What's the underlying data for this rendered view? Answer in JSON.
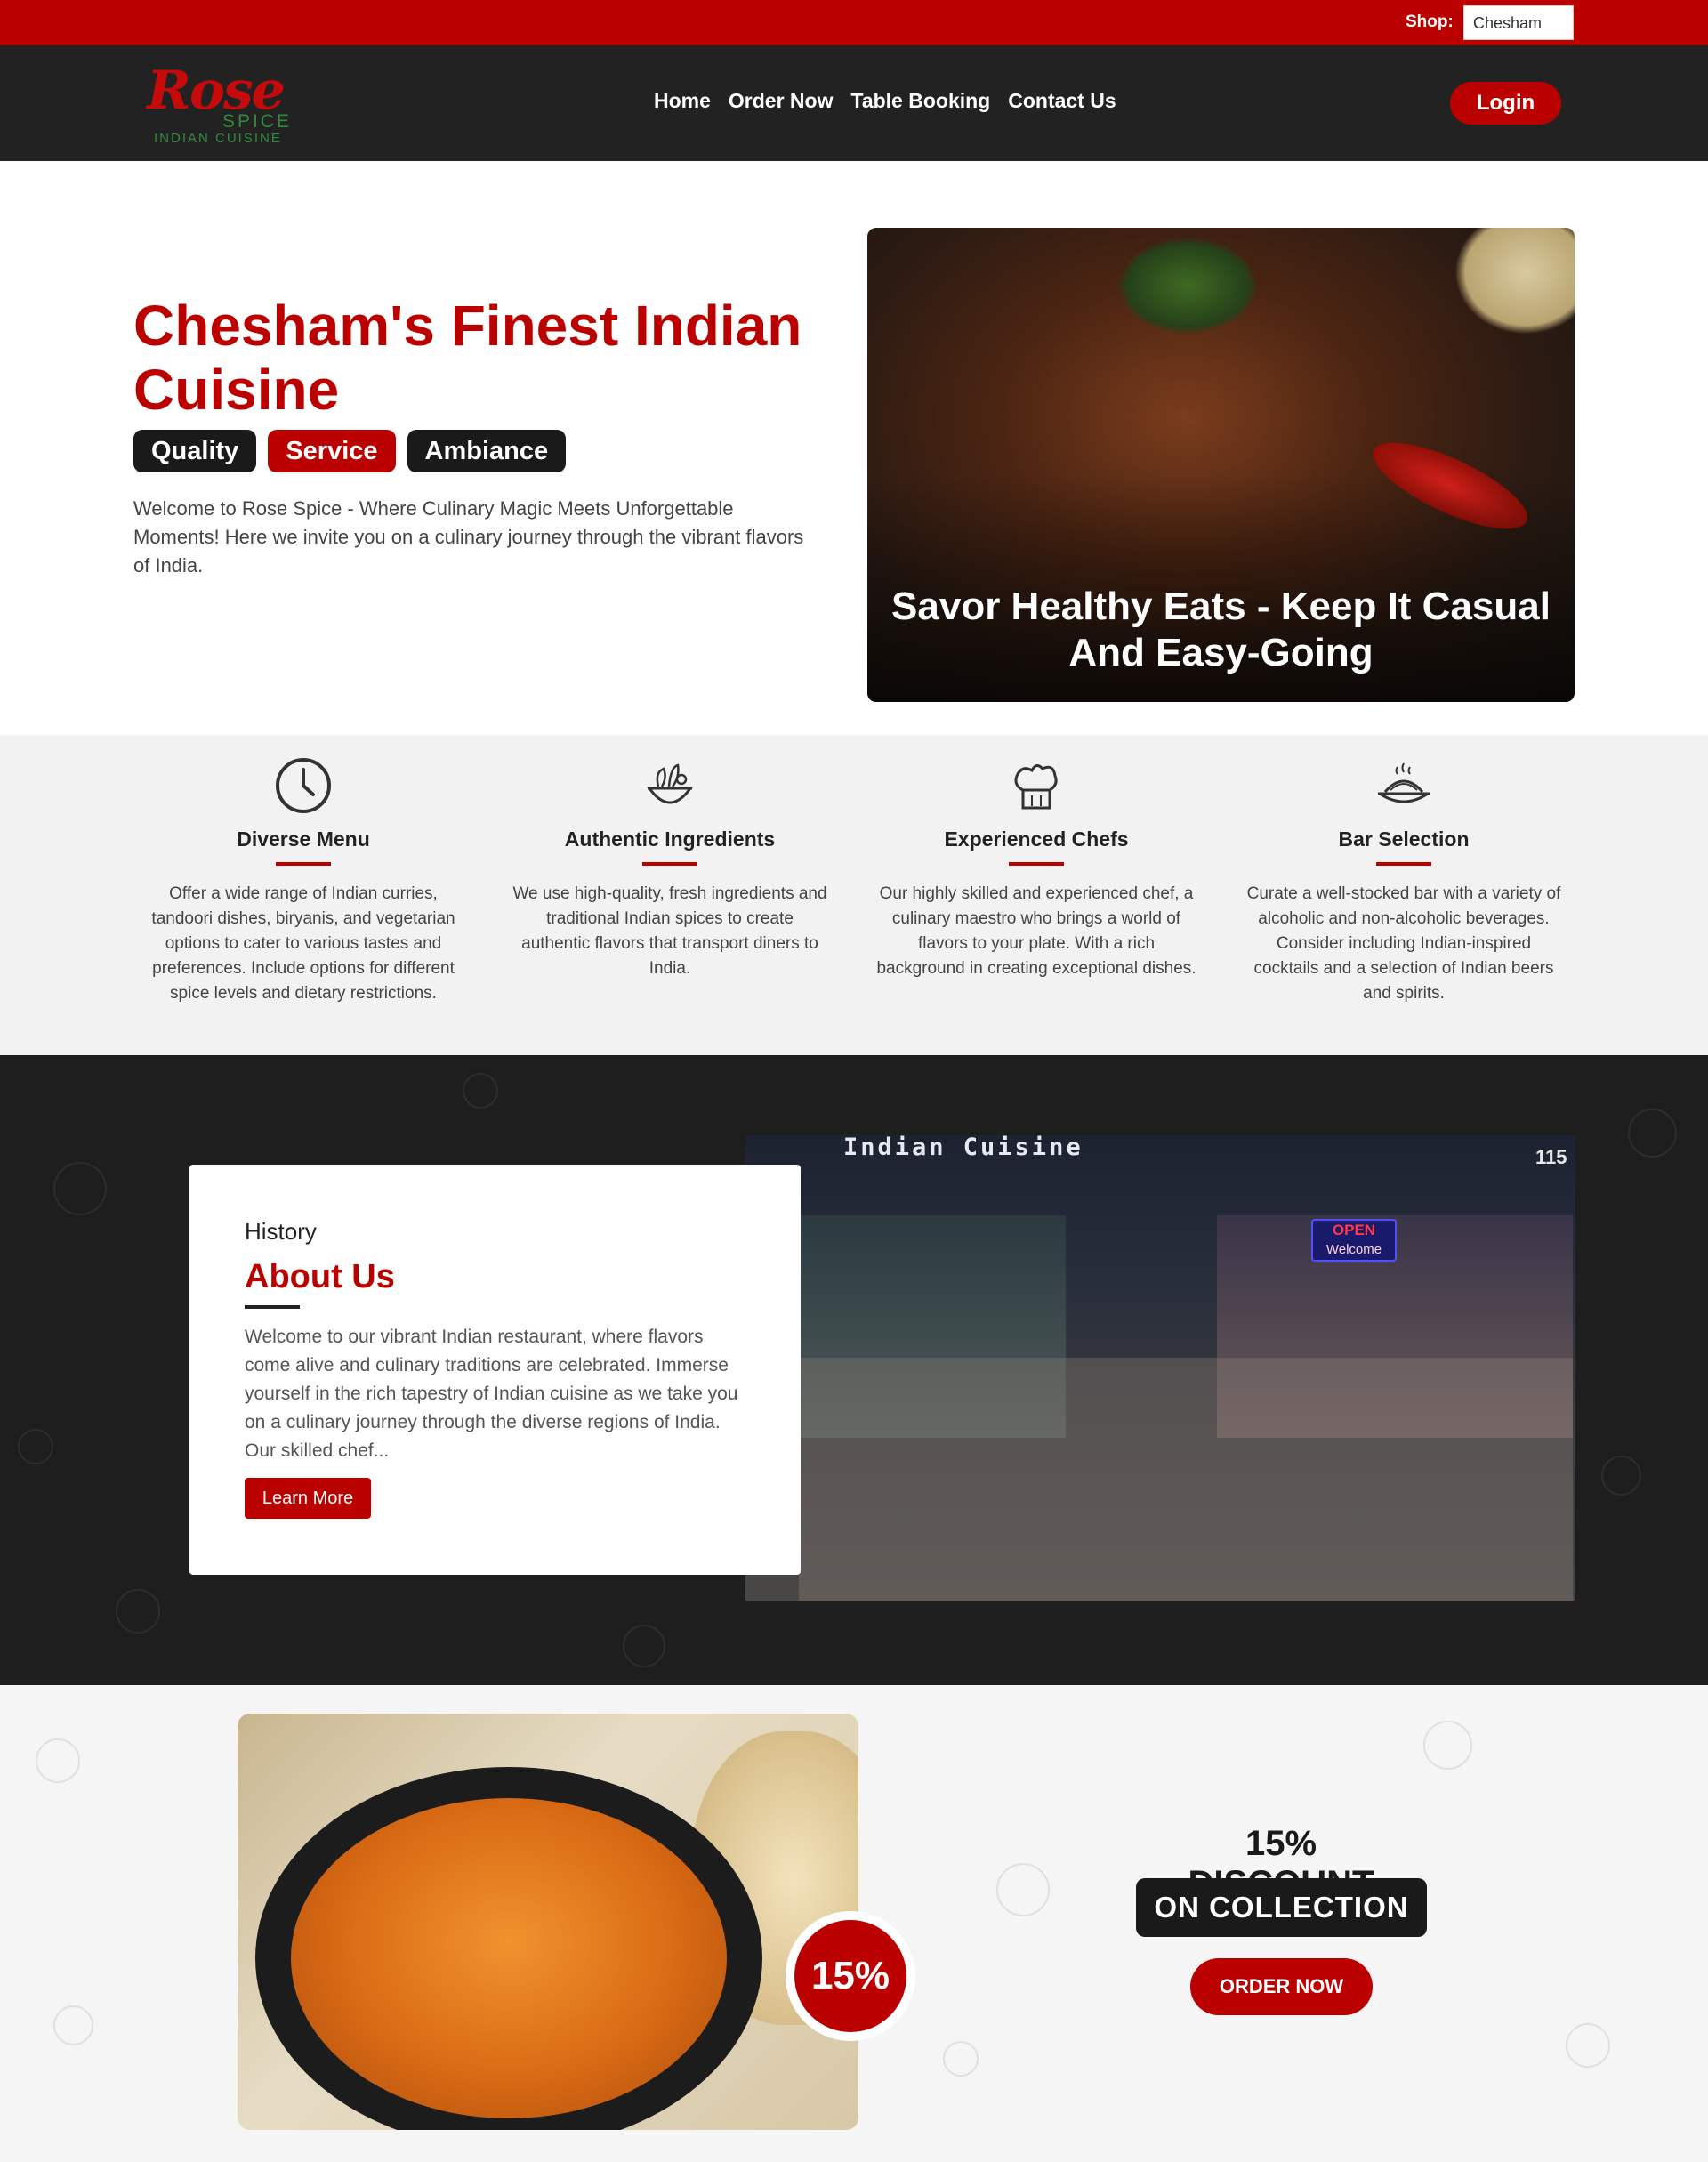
{
  "topbar": {
    "shop_label": "Shop:",
    "shop_selected": "Chesham"
  },
  "logo": {
    "script": "Rose",
    "spice": "SPICE",
    "sub": "INDIAN CUISINE"
  },
  "nav": {
    "items": [
      {
        "label": "Home"
      },
      {
        "label": "Order Now"
      },
      {
        "label": "Table Booking"
      },
      {
        "label": "Contact Us"
      }
    ],
    "login": "Login"
  },
  "hero": {
    "title": "Chesham's Finest Indian Cuisine",
    "pills": [
      "Quality",
      "Service",
      "Ambiance"
    ],
    "description": "Welcome to Rose Spice - Where Culinary Magic Meets Unforgettable Moments! Here we invite you on a culinary journey through the vibrant flavors of India.",
    "image_caption": "Savor Healthy Eats - Keep It Casual And Easy-Going"
  },
  "features": [
    {
      "icon": "clock-icon",
      "title": "Diverse Menu",
      "text": "Offer a wide range of Indian curries, tandoori dishes, biryanis, and vegetarian options to cater to various tastes and preferences. Include options for different spice levels and dietary restrictions."
    },
    {
      "icon": "salad-bowl-icon",
      "title": "Authentic Ingredients",
      "text": "We use high-quality, fresh ingredients and traditional Indian spices to create authentic flavors that transport diners to India."
    },
    {
      "icon": "chef-hat-icon",
      "title": "Experienced Chefs",
      "text": "Our highly skilled and experienced chef, a culinary maestro who brings a world of flavors to your plate. With a rich background in creating exceptional dishes."
    },
    {
      "icon": "hot-dish-icon",
      "title": "Bar Selection",
      "text": "Curate a well-stocked bar with a variety of alcoholic and non-alcoholic beverages. Consider including Indian-inspired cocktails and a selection of Indian beers and spirits."
    }
  ],
  "about": {
    "kicker": "History",
    "title": "About Us",
    "text": "Welcome to our vibrant Indian restaurant, where flavors come alive and culinary traditions are celebrated. Immerse yourself in the rich tapestry of Indian cuisine as we take you on a culinary journey through the diverse regions of India. Our skilled chef...",
    "button": "Learn More",
    "store_sign": "Indian Cuisine",
    "store_number": "115",
    "open_sign": "OPEN",
    "open_sign_sub": "Welcome"
  },
  "promo": {
    "badge": "15%",
    "title": "15% DISCOUNT",
    "subtitle": "ON COLLECTION",
    "button": "ORDER NOW"
  },
  "colors": {
    "brand_red": "#bb0000",
    "dark": "#222222",
    "feature_bg": "#f2f2f2"
  }
}
